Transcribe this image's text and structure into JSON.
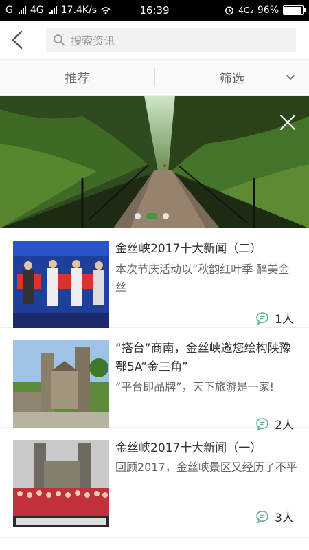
{
  "status_bar": {
    "carrier1": "G",
    "carrier2": "4G",
    "speed": "17.4K/s",
    "time": "16:39",
    "network": "4G₂",
    "battery": "96%",
    "battery_level": 0.96
  },
  "search": {
    "placeholder": "搜索资讯"
  },
  "tabs": {
    "recommend": "推荐",
    "filter": "筛选"
  },
  "banner": {
    "slide_count": 3,
    "active_slide": 1
  },
  "news": [
    {
      "title": "金丝峡2017十大新闻（二）",
      "summary": "本次节庆活动以“秋韵红叶季 醉美金丝",
      "comments": "1人"
    },
    {
      "title": "“搭台”商南，金丝峡邀您绘构陕豫鄂5A“金三角”",
      "summary": "“平台即品牌”，天下旅游是一家!",
      "comments": "2人"
    },
    {
      "title": "金丝峡2017十大新闻（一）",
      "summary": "回顾2017，金丝峡景区又经历了不平",
      "comments": "3人"
    }
  ],
  "colors": {
    "accent_green": "#3b9a3b",
    "comment_icon": "#5bb08d"
  }
}
